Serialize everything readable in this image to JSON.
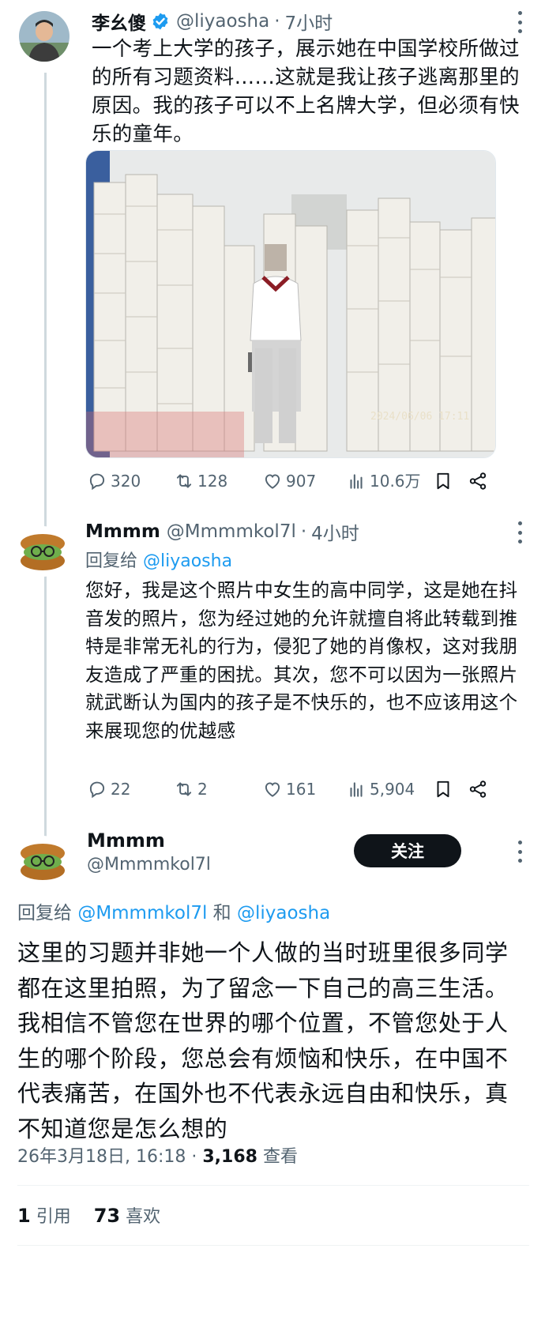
{
  "tweet1": {
    "name": "李幺傻",
    "handle": "@liyaosha",
    "sep": "·",
    "time": "7小时",
    "text": "一个考上大学的孩子，展示她在中国学校所做过的所有习题资料……这就是我让孩子逃离那里的原因。我的孩子可以不上名牌大学，但必须有快乐的童年。",
    "photo_timestamp": "2024/06/06 17:11",
    "replies": "320",
    "retweets": "128",
    "likes": "907",
    "views": "10.6万"
  },
  "tweet2": {
    "name": "Mmmm",
    "handle": "@Mmmmkol7l",
    "sep": "·",
    "time": "4小时",
    "reply_prefix": "回复给 ",
    "reply_mention": "@liyaosha",
    "text": "您好，我是这个照片中女生的高中同学，这是她在抖音发的照片，您为经过她的允许就擅自将此转载到推特是非常无礼的行为，侵犯了她的肖像权，这对我朋友造成了严重的困扰。其次，您不可以因为一张照片就武断认为国内的孩子是不快乐的，也不应该用这个来展现您的优越感",
    "replies": "22",
    "retweets": "2",
    "likes": "161",
    "views": "5,904"
  },
  "tweet3": {
    "name": "Mmmm",
    "handle": "@Mmmmkol7l",
    "follow_label": "关注",
    "reply_prefix": "回复给 ",
    "reply_mention1": "@Mmmmkol7l",
    "reply_and": " 和 ",
    "reply_mention2": "@liyaosha",
    "text": "这里的习题并非她一个人做的当时班里很多同学都在这里拍照，为了留念一下自己的高三生活。我相信不管您在世界的哪个位置，不管您处于人生的哪个阶段，您总会有烦恼和快乐，在中国不代表痛苦，在国外也不代表永远自由和快乐，真不知道您是怎么想的",
    "date": "26年3月18日, 16:18",
    "meta_sep": " · ",
    "views_count": "3,168",
    "views_label": " 查看",
    "quote_count": "1",
    "quote_label": " 引用",
    "like_count": "73",
    "like_label": " 喜欢"
  },
  "colors": {
    "accent": "#1d9bf0",
    "muted": "#536471",
    "text": "#0f1419",
    "line": "#cfd9de"
  }
}
